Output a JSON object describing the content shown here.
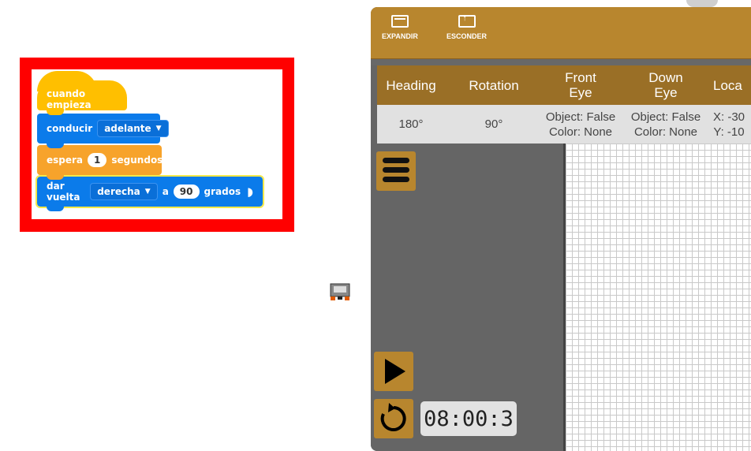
{
  "code": {
    "hat_label": "cuando empieza",
    "drive": {
      "label": "conducir",
      "direction": "adelante"
    },
    "wait": {
      "label": "espera",
      "value": "1",
      "unit": "segundos"
    },
    "turn": {
      "label": "dar vuelta",
      "direction": "derecha",
      "joiner": "a",
      "value": "90",
      "unit": "grados"
    },
    "colors": {
      "events": "#ffbf00",
      "motion": "#0b7bea",
      "control": "#f7a32b",
      "frame": "#ff0000"
    }
  },
  "toolbar": {
    "expand_label": "EXPANDIR",
    "hide_label": "ESCONDER"
  },
  "table": {
    "headers": [
      "Heading",
      "Rotation",
      "Front\nEye",
      "Down\nEye",
      "Loca"
    ],
    "values": [
      "180°",
      "90°",
      "Object: False\nColor: None",
      "Object: False\nColor: None",
      "X: -30\nY: -10"
    ]
  },
  "timer": "08:00:3",
  "icons": [
    "expand-icon",
    "hide-icon",
    "menu-icon",
    "play-icon",
    "reset-icon",
    "robot-icon"
  ],
  "theme": {
    "accent": "#b8862e",
    "header": "#9a6f26",
    "panel": "#656565"
  }
}
